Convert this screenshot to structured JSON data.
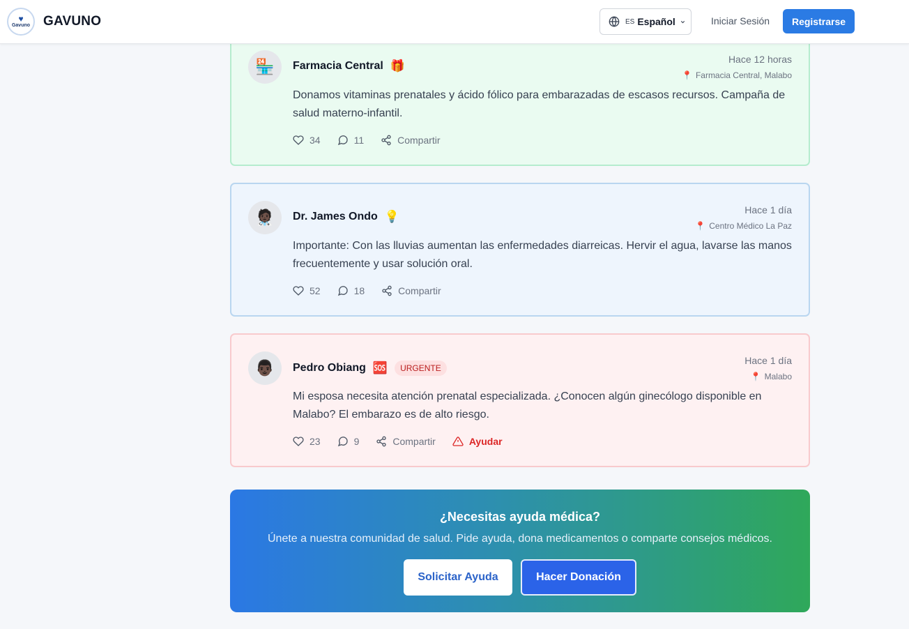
{
  "header": {
    "logo_text": "Gavuno",
    "brand": "GAVUNO",
    "language_code": "ES",
    "language_name": "Español",
    "login_label": "Iniciar Sesión",
    "register_label": "Registrarse"
  },
  "posts": [
    {
      "author": "Farmacia Central",
      "tag_emoji": "🎁",
      "avatar_emoji": "🏪",
      "time": "Hace 12 horas",
      "location": "Farmacia Central, Malabo",
      "content": "Donamos vitaminas prenatales y ácido fólico para embarazadas de escasos recursos. Campaña de salud materno-infantil.",
      "likes": "34",
      "comments": "11",
      "share_label": "Compartir"
    },
    {
      "author": "Dr. James Ondo",
      "tag_emoji": "💡",
      "avatar_emoji": "🧑🏿‍⚕️",
      "time": "Hace 1 día",
      "location": "Centro Médico La Paz",
      "content": "Importante: Con las lluvias aumentan las enfermedades diarreicas. Hervir el agua, lavarse las manos frecuentemente y usar solución oral.",
      "likes": "52",
      "comments": "18",
      "share_label": "Compartir"
    },
    {
      "author": "Pedro Obiang",
      "tag_emoji": "🆘",
      "badge": "URGENTE",
      "avatar_emoji": "👨🏿",
      "time": "Hace 1 día",
      "location": "Malabo",
      "content": "Mi esposa necesita atención prenatal especializada. ¿Conocen algún ginecólogo disponible en Malabo? El embarazo es de alto riesgo.",
      "likes": "23",
      "comments": "9",
      "share_label": "Compartir",
      "help_label": "Ayudar"
    }
  ],
  "cta": {
    "title": "¿Necesitas ayuda médica?",
    "subtitle": "Únete a nuestra comunidad de salud. Pide ayuda, dona medicamentos o comparte consejos médicos.",
    "help_button": "Solicitar Ayuda",
    "donate_button": "Hacer Donación"
  },
  "icons": {
    "language": "globe-icon",
    "dropdown": "chevron-down-icon",
    "like": "heart-icon",
    "comment": "comment-icon",
    "share": "share-icon",
    "location": "map-pin-icon",
    "urgent_help": "warning-triangle-icon"
  },
  "colors": {
    "primary": "#2b7be4",
    "green_post_bg": "#eafbf1",
    "blue_post_bg": "#eef5fd",
    "red_post_bg": "#fef1f2",
    "urgent": "#dc2626",
    "cta_gradient_start": "#2b78e4",
    "cta_gradient_end": "#2fa85a"
  }
}
